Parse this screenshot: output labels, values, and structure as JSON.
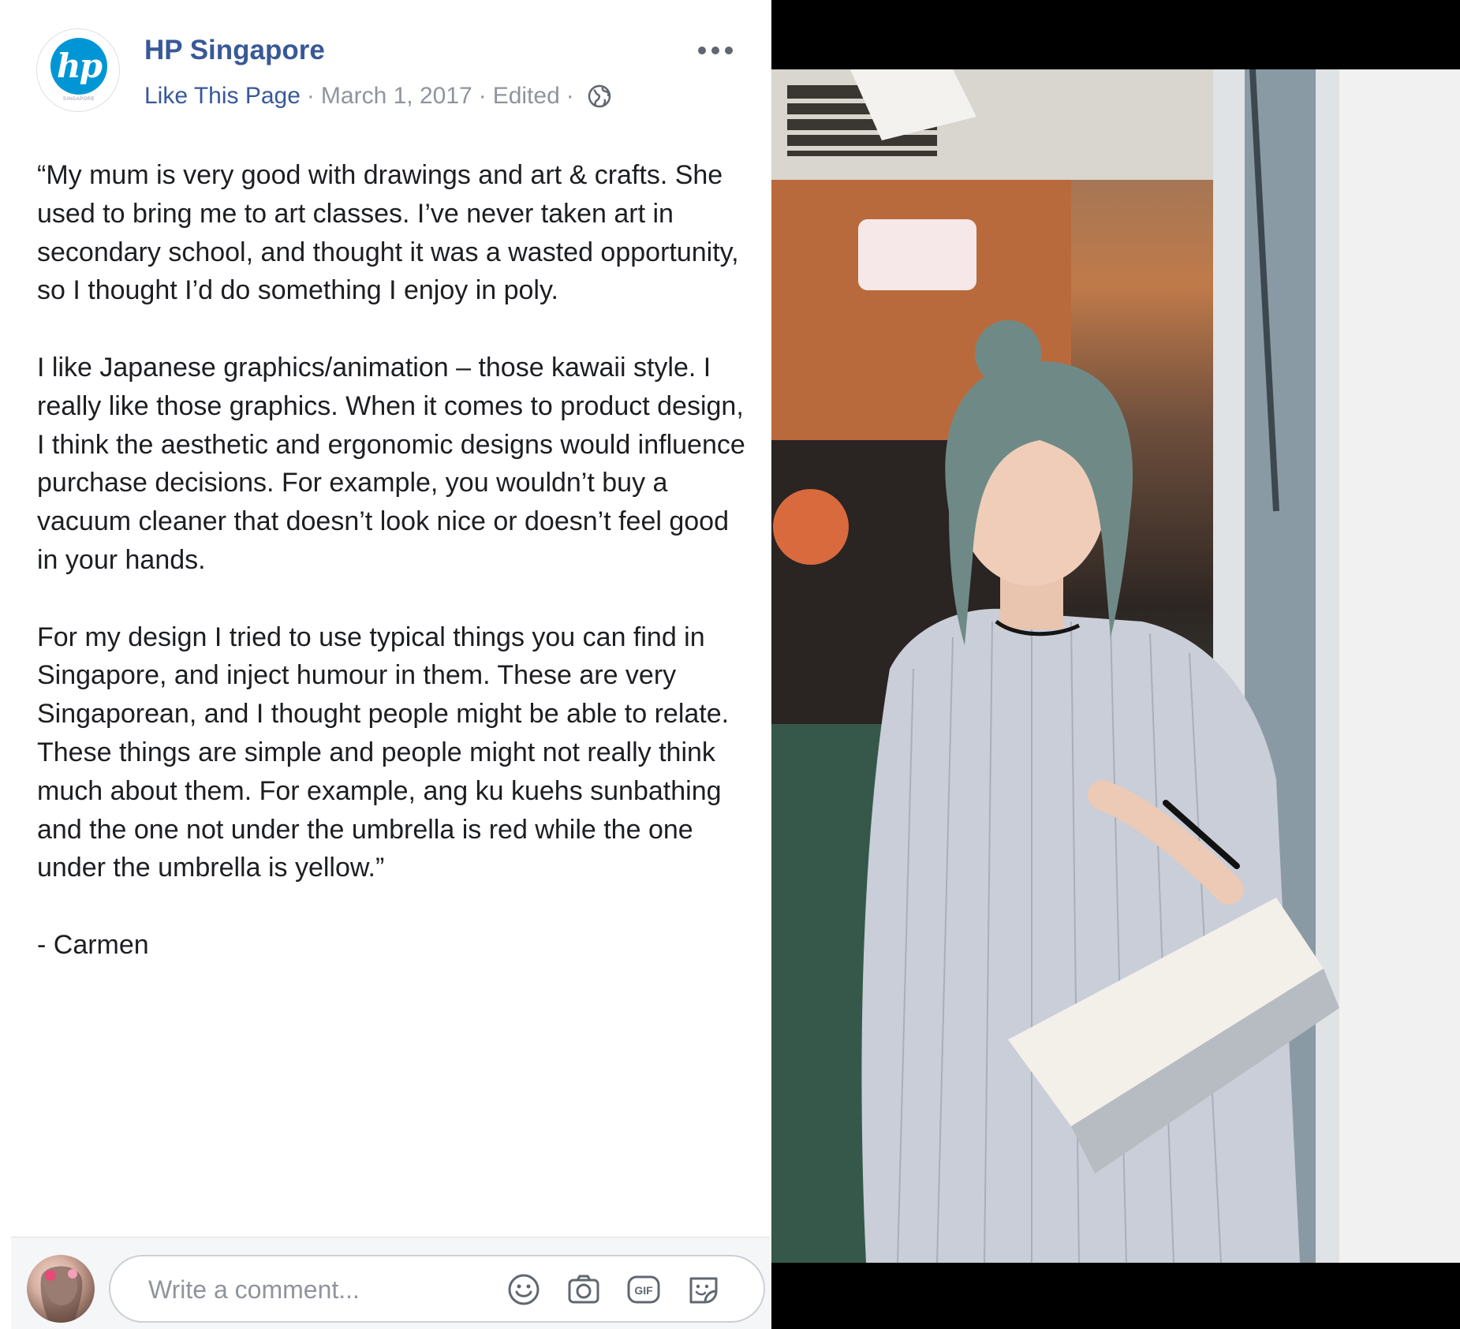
{
  "post": {
    "page_name": "HP Singapore",
    "like_link": "Like This Page",
    "separator": "·",
    "date": "March 1, 2017",
    "edited": "Edited",
    "logo_text": "hp",
    "logo_subtext": "SINGAPORE",
    "paragraphs": [
      "“My mum is very good with drawings and art & crafts. She used to bring me to art classes. I’ve never taken art in secondary school, and thought it was a wasted opportunity, so I thought I’d do something I enjoy in poly.",
      "I like Japanese graphics/animation – those kawaii style. I really like those graphics. When it comes to product design, I think the aesthetic and ergonomic designs would influence purchase decisions. For example, you wouldn’t buy a vacuum cleaner that doesn’t look nice or doesn’t feel good in your hands.",
      "For my design I tried to use typical things you can find in Singapore, and inject humour in them. These are very Singaporean, and I thought people might be able to relate. These things are simple and people might not really think much about them. For example, ang ku kuehs sunbathing and the one not under the umbrella is red while the one under the umbrella is yellow.”",
      "- Carmen"
    ]
  },
  "comment": {
    "placeholder": "Write a comment...",
    "gif_label": "GIF"
  },
  "icons": {
    "more": "more-options-icon",
    "globe": "globe-icon",
    "emoji": "emoji-icon",
    "camera": "camera-icon",
    "gif": "gif-icon",
    "sticker": "sticker-icon"
  },
  "colors": {
    "link": "#385898",
    "meta": "#90949c",
    "text": "#1c1e21",
    "hp_blue": "#0096d6"
  }
}
